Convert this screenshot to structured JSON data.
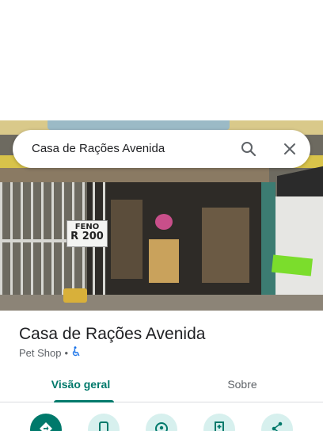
{
  "search": {
    "query": "Casa de Rações Avenida"
  },
  "photo": {
    "feno_sign": {
      "line1": "FENO",
      "line2": "R 200"
    }
  },
  "place": {
    "title": "Casa de Rações Avenida",
    "category": "Pet Shop",
    "separator": "•",
    "accessibility_icon": "wheelchair-icon"
  },
  "tabs": [
    {
      "label": "Visão geral",
      "selected": true
    },
    {
      "label": "Sobre",
      "selected": false
    }
  ],
  "actions": [
    {
      "icon": "directions-icon"
    },
    {
      "icon": "phone-icon"
    },
    {
      "icon": "location-icon"
    },
    {
      "icon": "save-icon"
    },
    {
      "icon": "share-icon"
    }
  ],
  "colors": {
    "accent": "#00796b",
    "action_bg": "#d7f0ee",
    "text_primary": "#202124",
    "text_secondary": "#5f6368"
  }
}
